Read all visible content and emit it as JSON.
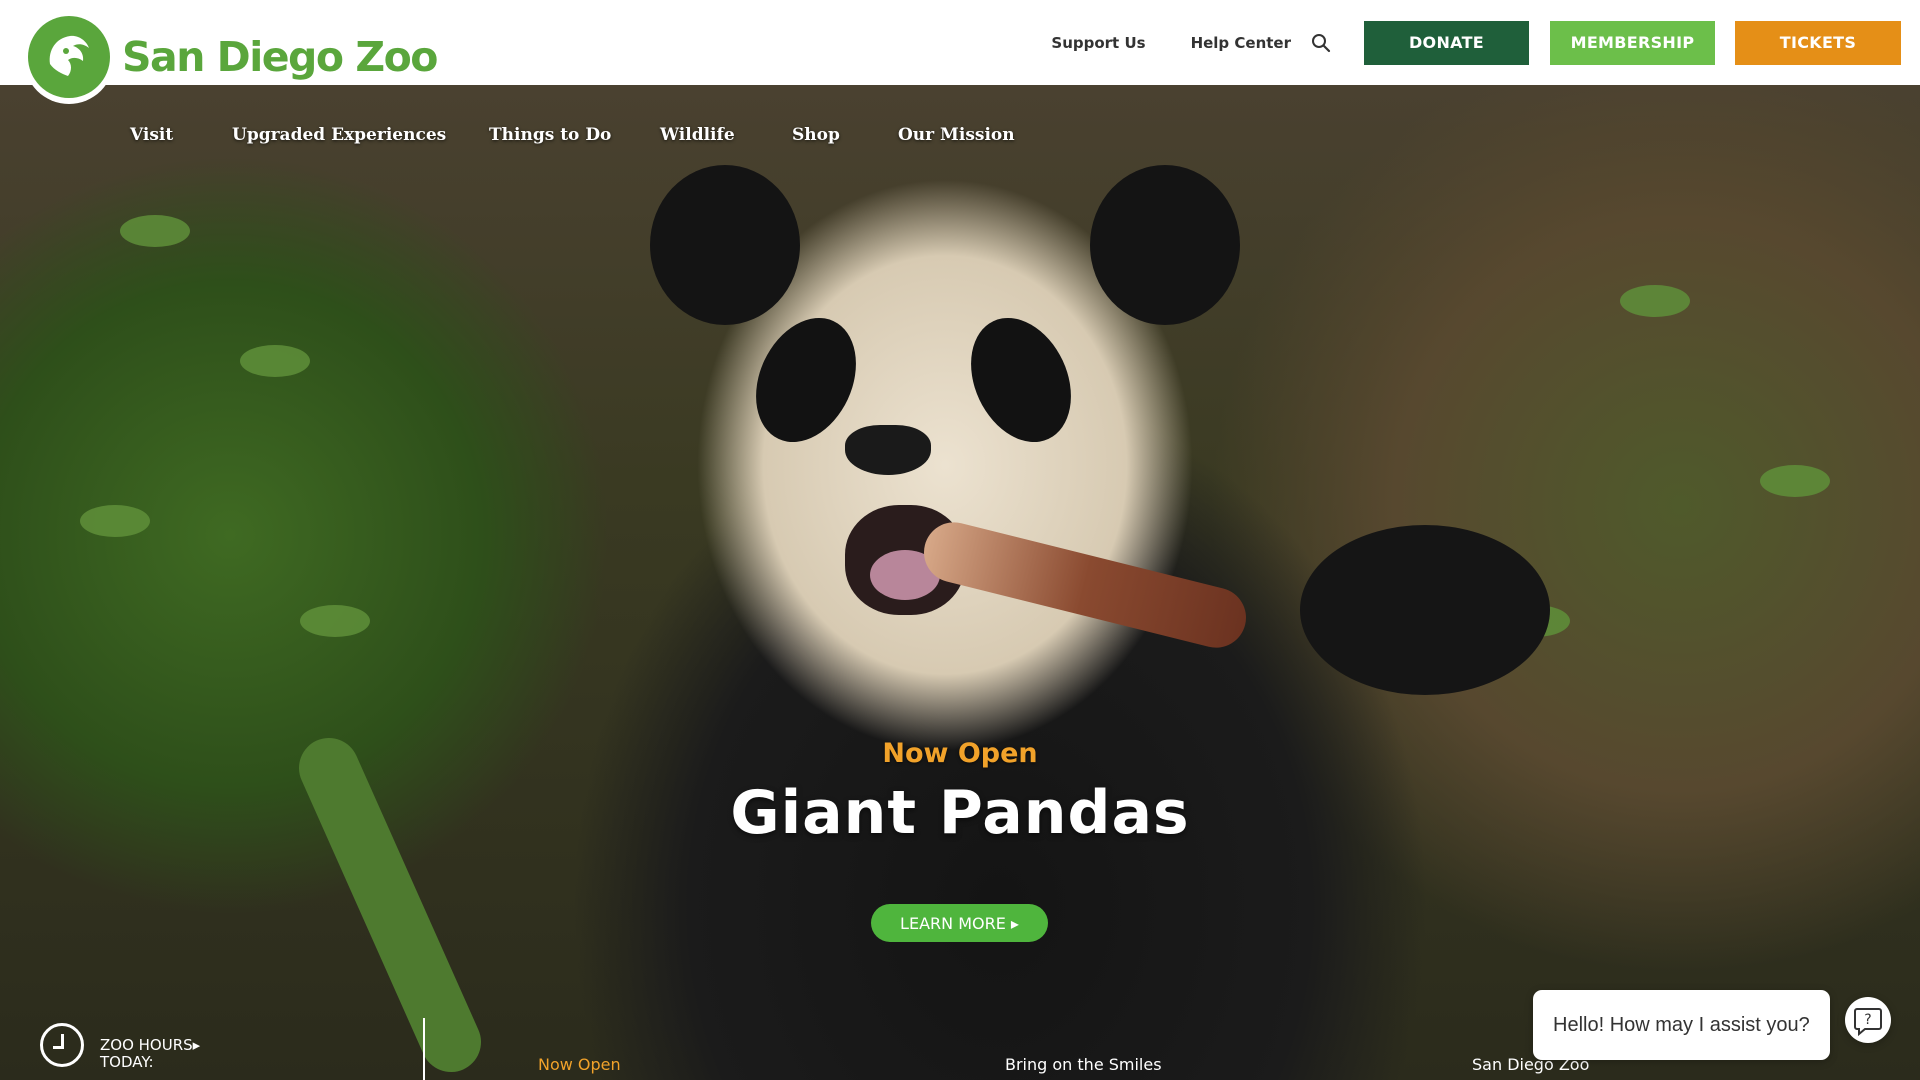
{
  "header": {
    "logo_text": "San Diego Zoo",
    "utility_links": [
      {
        "label": "Support Us"
      },
      {
        "label": "Help Center"
      }
    ],
    "search_icon": "search-icon",
    "buttons": {
      "donate": "DONATE",
      "membership": "MEMBERSHIP",
      "tickets": "TICKETS"
    },
    "colors": {
      "brand_green": "#5aa63c",
      "donate": "#1f5f3a",
      "membership": "#6cbf4a",
      "tickets": "#e58f17"
    }
  },
  "nav": {
    "items": [
      {
        "label": "Visit"
      },
      {
        "label": "Upgraded Experiences"
      },
      {
        "label": "Things to Do"
      },
      {
        "label": "Wildlife"
      },
      {
        "label": "Shop"
      },
      {
        "label": "Our Mission"
      }
    ]
  },
  "hero": {
    "eyebrow": "Now Open",
    "title": "Giant Pandas",
    "cta": "LEARN MORE ▸",
    "eyebrow_color": "#f1a22a",
    "cta_color": "#4fb53d"
  },
  "bottom": {
    "hours_line1": "ZOO HOURS▸",
    "hours_line2": "TODAY:",
    "clock_icon": "clock-icon",
    "strip": [
      {
        "label": "Now Open",
        "active": true
      },
      {
        "label": "Bring on the Smiles",
        "active": false
      },
      {
        "label": "San Diego Zoo",
        "active": false
      }
    ]
  },
  "chat": {
    "message": "Hello! How may I assist you?",
    "help_icon": "question-icon"
  }
}
